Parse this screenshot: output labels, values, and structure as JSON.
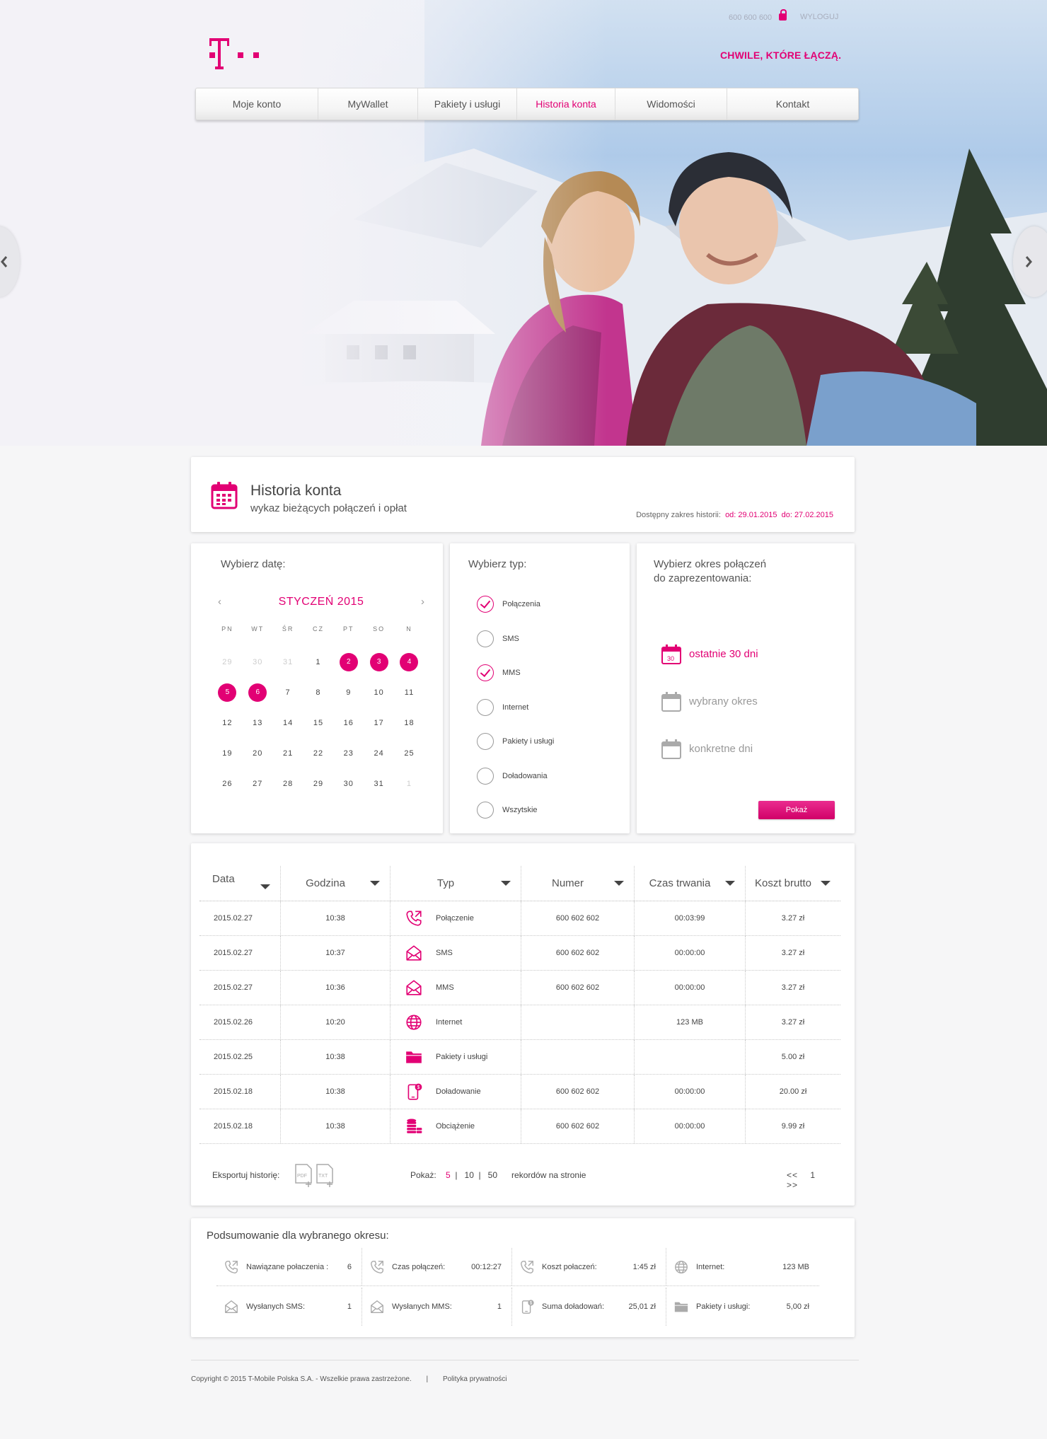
{
  "header": {
    "phone": "600 600 600",
    "logout": "WYLOGUJ",
    "tagline": "CHWILE, KTÓRE ŁĄCZĄ."
  },
  "nav": [
    {
      "label": "Moje konto",
      "active": false
    },
    {
      "label": "MyWallet",
      "active": false
    },
    {
      "label": "Pakiety i usługi",
      "active": false
    },
    {
      "label": "Historia konta",
      "active": true
    },
    {
      "label": "Widomości",
      "active": false
    },
    {
      "label": "Kontakt",
      "active": false
    }
  ],
  "page": {
    "title": "Historia konta",
    "subtitle": "wykaz bieżących połączeń i opłat",
    "range_label": "Dostępny zakres historii:",
    "range_from": "od: 29.01.2015",
    "range_to": "do: 27.02.2015"
  },
  "calendar": {
    "title": "Wybierz datę:",
    "month": "STYCZEŃ 2015",
    "prev": "‹",
    "next": "›",
    "days_of_week": [
      "PN",
      "WT",
      "ŚR",
      "CZ",
      "PT",
      "SO",
      "N"
    ],
    "weeks": [
      [
        {
          "d": "29",
          "out": true
        },
        {
          "d": "30",
          "out": true
        },
        {
          "d": "31",
          "out": true
        },
        {
          "d": "1"
        },
        {
          "d": "2",
          "sel": true
        },
        {
          "d": "3",
          "sel": true
        },
        {
          "d": "4",
          "sel": true
        }
      ],
      [
        {
          "d": "5",
          "sel": true
        },
        {
          "d": "6",
          "sel": true
        },
        {
          "d": "7"
        },
        {
          "d": "8"
        },
        {
          "d": "9"
        },
        {
          "d": "10"
        },
        {
          "d": "11"
        }
      ],
      [
        {
          "d": "12"
        },
        {
          "d": "13"
        },
        {
          "d": "14"
        },
        {
          "d": "15"
        },
        {
          "d": "16"
        },
        {
          "d": "17"
        },
        {
          "d": "18"
        }
      ],
      [
        {
          "d": "19"
        },
        {
          "d": "20"
        },
        {
          "d": "21"
        },
        {
          "d": "22"
        },
        {
          "d": "23"
        },
        {
          "d": "24"
        },
        {
          "d": "25"
        }
      ],
      [
        {
          "d": "26"
        },
        {
          "d": "27"
        },
        {
          "d": "28"
        },
        {
          "d": "29"
        },
        {
          "d": "30"
        },
        {
          "d": "31"
        },
        {
          "d": "1",
          "out": true
        }
      ]
    ]
  },
  "types": {
    "title": "Wybierz  typ:",
    "items": [
      {
        "label": "Połączenia",
        "checked": true
      },
      {
        "label": "SMS",
        "checked": false
      },
      {
        "label": "MMS",
        "checked": true
      },
      {
        "label": "Internet",
        "checked": false
      },
      {
        "label": "Pakiety i usługi",
        "checked": false
      },
      {
        "label": "Doładowania",
        "checked": false
      },
      {
        "label": "Wszytskie",
        "checked": false
      }
    ]
  },
  "period": {
    "title_line1": "Wybierz okres połączeń",
    "title_line2": "do zaprezentowania:",
    "options": [
      {
        "label": "ostatnie 30 dni",
        "selected": true,
        "icon_num": "30"
      },
      {
        "label": "wybrany okres",
        "selected": false
      },
      {
        "label": "konkretne dni",
        "selected": false
      }
    ],
    "button": "Pokaż"
  },
  "table": {
    "columns": [
      "Data",
      "Godzina",
      "Typ",
      "Numer",
      "Czas trwania",
      "Koszt brutto"
    ],
    "rows": [
      {
        "date": "2015.02.27",
        "time": "10:38",
        "type": "Połączenie",
        "icon": "phone-call-icon",
        "number": "600 602 602",
        "duration": "00:03:99",
        "cost": "3.27 zł"
      },
      {
        "date": "2015.02.27",
        "time": "10:37",
        "type": "SMS",
        "icon": "envelope-icon",
        "number": "600 602 602",
        "duration": "00:00:00",
        "cost": "3.27 zł"
      },
      {
        "date": "2015.02.27",
        "time": "10:36",
        "type": "MMS",
        "icon": "envelope-icon",
        "number": "600 602 602",
        "duration": "00:00:00",
        "cost": "3.27 zł"
      },
      {
        "date": "2015.02.26",
        "time": "10:20",
        "type": "Internet",
        "icon": "globe-icon",
        "number": "",
        "duration": "123 MB",
        "cost": "3.27 zł"
      },
      {
        "date": "2015.02.25",
        "time": "10:38",
        "type": "Pakiety i usługi",
        "icon": "folder-icon",
        "number": "",
        "duration": "",
        "cost": "5.00 zł"
      },
      {
        "date": "2015.02.18",
        "time": "10:38",
        "type": "Doładowanie",
        "icon": "mobile-topup-icon",
        "number": "600 602 602",
        "duration": "00:00:00",
        "cost": "20.00 zł"
      },
      {
        "date": "2015.02.18",
        "time": "10:38",
        "type": "Obciążenie",
        "icon": "coins-icon",
        "number": "600 602 602",
        "duration": "00:00:00",
        "cost": "9.99 zł"
      }
    ],
    "export_label": "Eksportuj historię:",
    "export_formats": [
      "PDF",
      "TXT"
    ],
    "show_label": "Pokaż:",
    "page_sizes": [
      "5",
      "10",
      "50"
    ],
    "page_size_selected": "5",
    "records_label": "rekordów na stronie",
    "pagination": {
      "prev": "<<",
      "current": "1",
      "next": ">>"
    }
  },
  "summary": {
    "title": "Podsumowanie dla wybranego okresu:",
    "row1": [
      {
        "label": "Nawiązane połaczenia :",
        "value": "6",
        "icon": "phone-call-icon"
      },
      {
        "label": "Czas połączeń:",
        "value": "00:12:27",
        "icon": "phone-call-icon"
      },
      {
        "label": "Koszt połaczeń:",
        "value": "1:45 zł",
        "icon": "phone-call-icon"
      },
      {
        "label": "Internet:",
        "value": "123 MB",
        "icon": "globe-icon"
      }
    ],
    "row2": [
      {
        "label": "Wysłanych SMS:",
        "value": "1",
        "icon": "envelope-icon"
      },
      {
        "label": "Wysłanych MMS:",
        "value": "1",
        "icon": "envelope-icon"
      },
      {
        "label": "Suma doładowań:",
        "value": "25,01 zł",
        "icon": "mobile-topup-icon"
      },
      {
        "label": "Pakiety i usługi:",
        "value": "5,00 zł",
        "icon": "folder-icon"
      }
    ]
  },
  "footer": {
    "copyright": "Copyright © 2015 T-Mobile Polska S.A. - Wszelkie prawa zastrzeżone.",
    "separator": "|",
    "privacy": "Polityka prywatności"
  },
  "colors": {
    "accent": "#e20074",
    "muted_icon": "#aaaaaa"
  }
}
